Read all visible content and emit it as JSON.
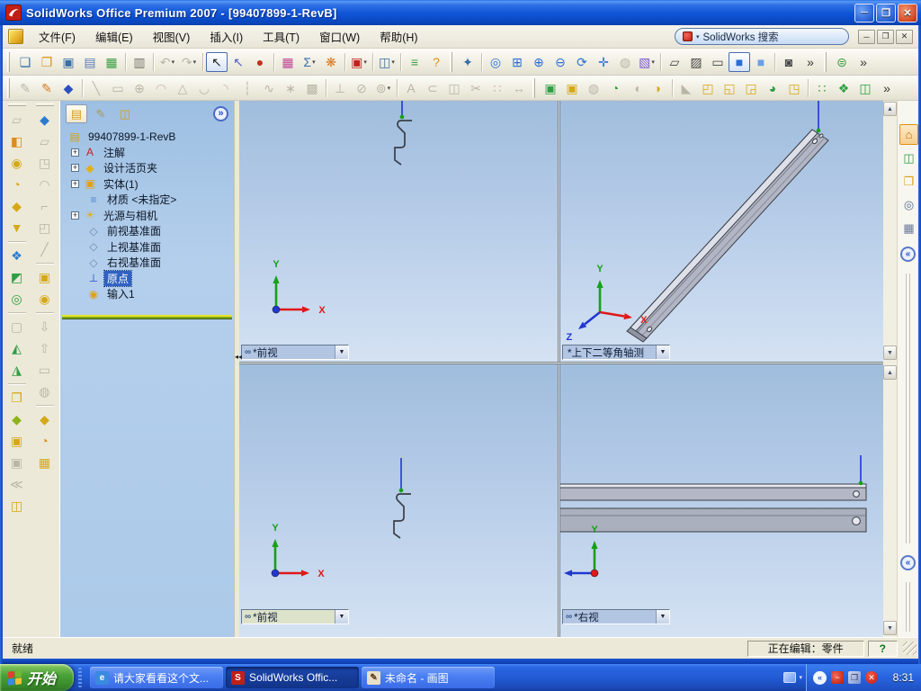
{
  "colors": {
    "titlebar_blue": "#0f54d8",
    "taskbar_blue": "#2159d2",
    "viewport_blue_top": "#a0bddd",
    "viewport_blue_bottom": "#d4e2f3",
    "selection_blue": "#2f62c2",
    "axis_x_red": "#e01818",
    "axis_y_green": "#18a018",
    "axis_z_blue": "#2038d0",
    "active_view_label": "#dde2ca"
  },
  "window": {
    "title": "SolidWorks Office Premium 2007 - [99407899-1-RevB]",
    "controls": {
      "minimize": "─",
      "restore": "❐",
      "close": "✕"
    }
  },
  "glyphs": {
    "dropdown": "▾",
    "combo_arrow": "▼",
    "link": "∞",
    "chev_right": "»",
    "chev_left": "«",
    "up": "▲",
    "down": "▼",
    "splitter_left": "◂◂",
    "plus": "+"
  },
  "menu": {
    "items": [
      {
        "n": "menu-file",
        "label": "文件(F)"
      },
      {
        "n": "menu-edit",
        "label": "编辑(E)"
      },
      {
        "n": "menu-view",
        "label": "视图(V)"
      },
      {
        "n": "menu-insert",
        "label": "插入(I)"
      },
      {
        "n": "menu-tools",
        "label": "工具(T)"
      },
      {
        "n": "menu-window",
        "label": "窗口(W)"
      },
      {
        "n": "menu-help",
        "label": "帮助(H)"
      }
    ],
    "search": {
      "text": "SolidWorks 搜索"
    }
  },
  "toolbars": {
    "main": [
      {
        "grip": 1
      },
      {
        "n": "new-document-icon",
        "g": "❏",
        "c": "#3a6ea5"
      },
      {
        "n": "open-icon",
        "g": "❐",
        "c": "#d89020"
      },
      {
        "n": "save-icon",
        "g": "▣",
        "c": "#3a6ea5"
      },
      {
        "n": "make-drawing-icon",
        "g": "▤",
        "c": "#5a7ab8"
      },
      {
        "n": "make-assembly-icon",
        "g": "▦",
        "c": "#3f9e44"
      },
      {
        "sep": 1
      },
      {
        "n": "print-icon",
        "g": "▥",
        "c": "#77736a"
      },
      {
        "sep": 1
      },
      {
        "n": "undo-icon",
        "g": "↶",
        "d": 1,
        "drop": 1
      },
      {
        "n": "redo-icon",
        "g": "↷",
        "d": 1,
        "drop": 1
      },
      {
        "sep": 1
      },
      {
        "n": "select-icon",
        "g": "↖",
        "c": "#222222",
        "p": 1
      },
      {
        "n": "select-filter-icon",
        "g": "↖",
        "c": "#5560c0"
      },
      {
        "n": "rebuild-icon",
        "g": "●",
        "c": "#c03020"
      },
      {
        "sep": 1
      },
      {
        "n": "edit-color-icon",
        "g": "▦",
        "c": "#c04898"
      },
      {
        "n": "texture-icon",
        "g": "Σ",
        "c": "#3a6ea5",
        "drop": 1
      },
      {
        "n": "photoworks-icon",
        "g": "❋",
        "c": "#d87820"
      },
      {
        "sep": 1
      },
      {
        "n": "solidworks-addins-icon",
        "g": "▣",
        "c": "#c42020",
        "drop": 1
      },
      {
        "sep": 1
      },
      {
        "n": "split-window-icon",
        "g": "◫",
        "c": "#3a6ea5",
        "drop": 1
      },
      {
        "sep": 1
      },
      {
        "n": "document-properties-icon",
        "g": "≡",
        "c": "#3f9e44"
      },
      {
        "n": "help-icon",
        "g": "?",
        "c": "#e09010"
      },
      {
        "grip": 1
      },
      {
        "n": "view-light-icon",
        "g": "✦",
        "c": "#3a6ea5"
      },
      {
        "sep": 1
      },
      {
        "n": "zoom-fit-icon",
        "g": "◎",
        "c": "#2a6ed5"
      },
      {
        "n": "zoom-area-icon",
        "g": "⊞",
        "c": "#2a6ed5"
      },
      {
        "n": "zoom-in-out-icon",
        "g": "⊕",
        "c": "#2a6ed5"
      },
      {
        "n": "zoom-selection-icon",
        "g": "⊖",
        "c": "#2a6ed5"
      },
      {
        "n": "rotate-view-icon",
        "g": "⟳",
        "c": "#2a6ed5"
      },
      {
        "n": "pan-icon",
        "g": "✛",
        "c": "#2a6ed5"
      },
      {
        "n": "standard-views-icon",
        "g": "◍",
        "d": 1
      },
      {
        "n": "view-orientation-icon",
        "g": "▧",
        "c": "#7a5ad0",
        "drop": 1
      },
      {
        "sep": 1
      },
      {
        "n": "wireframe-icon",
        "g": "▱",
        "c": "#444444"
      },
      {
        "n": "hidden-lines-visible-icon",
        "g": "▨",
        "c": "#444444"
      },
      {
        "n": "hidden-lines-removed-icon",
        "g": "▭",
        "c": "#444444"
      },
      {
        "n": "shaded-with-edges-icon",
        "g": "■",
        "c": "#2a6ed5",
        "p": 1
      },
      {
        "n": "shaded-icon",
        "g": "■",
        "c": "#6aa0e8"
      },
      {
        "sep": 1
      },
      {
        "n": "shadows-icon",
        "g": "◙",
        "c": "#444444"
      },
      {
        "n": "view-overflow-icon",
        "g": "»",
        "c": "#333333"
      },
      {
        "grip": 1
      },
      {
        "n": "enote-icon",
        "g": "⊜",
        "c": "#3f9e44"
      },
      {
        "n": "toolbar-overflow-icon",
        "g": "»",
        "c": "#333333"
      }
    ],
    "sketch": [
      {
        "grip": 1
      },
      {
        "n": "sketch-icon",
        "g": "✎",
        "d": 1
      },
      {
        "n": "3d-sketch-icon",
        "g": "✎",
        "c": "#d87820"
      },
      {
        "n": "modify-sketch-icon",
        "g": "◆",
        "c": "#2a50c0"
      },
      {
        "sep": 1
      },
      {
        "n": "line-icon",
        "g": "╲",
        "d": 1
      },
      {
        "n": "rectangle-icon",
        "g": "▭",
        "d": 1
      },
      {
        "n": "circle-icon",
        "g": "⊕",
        "d": 1
      },
      {
        "n": "centerpoint-arc-icon",
        "g": "◠",
        "d": 1
      },
      {
        "n": "polygon-icon",
        "g": "△",
        "d": 1
      },
      {
        "n": "tangent-arc-icon",
        "g": "◡",
        "d": 1
      },
      {
        "n": "three-point-arc-icon",
        "g": "◝",
        "d": 1
      },
      {
        "n": "centerline-icon",
        "g": "┆",
        "d": 1
      },
      {
        "n": "spline-icon",
        "g": "∿",
        "d": 1
      },
      {
        "n": "point-icon",
        "g": "∗",
        "d": 1
      },
      {
        "n": "hatch-icon",
        "g": "▩",
        "d": 1
      },
      {
        "sep": 1
      },
      {
        "n": "add-relation-icon",
        "g": "⊥",
        "d": 1
      },
      {
        "n": "smart-dimension-icon",
        "g": "⊘",
        "d": 1
      },
      {
        "n": "offset-entities-icon",
        "g": "⊚",
        "d": 1,
        "drop": 1
      },
      {
        "sep": 1
      },
      {
        "n": "note-icon",
        "g": "A",
        "d": 1
      },
      {
        "n": "convert-entities-icon",
        "g": "⊂",
        "d": 1
      },
      {
        "n": "mirror-entities-icon",
        "g": "◫",
        "d": 1
      },
      {
        "n": "trim-entities-icon",
        "g": "✂",
        "d": 1
      },
      {
        "n": "linear-sketch-pattern-icon",
        "g": "∷",
        "d": 1
      },
      {
        "n": "move-entities-icon",
        "g": "↔",
        "d": 1
      },
      {
        "grip": 1
      },
      {
        "n": "extruded-boss-icon",
        "g": "▣",
        "c": "#2f9e44"
      },
      {
        "n": "extruded-cut-icon",
        "g": "▣",
        "c": "#d5a818"
      },
      {
        "n": "revolved-boss-icon",
        "g": "◍",
        "d": 1
      },
      {
        "n": "swept-boss-icon",
        "g": "◔",
        "c": "#2f9e44"
      },
      {
        "n": "lofted-boss-icon",
        "g": "◖",
        "d": 1
      },
      {
        "n": "fillet-icon",
        "g": "◗",
        "c": "#d5a818"
      },
      {
        "sep": 1
      },
      {
        "n": "chamfer-icon",
        "g": "◣",
        "d": 1
      },
      {
        "n": "shell-icon",
        "g": "◰",
        "c": "#d5a818"
      },
      {
        "n": "draft-icon",
        "g": "◱",
        "c": "#d5a818"
      },
      {
        "n": "rib-icon",
        "g": "◲",
        "c": "#d5a818"
      },
      {
        "n": "dome-icon",
        "g": "◕",
        "c": "#2f9e44"
      },
      {
        "n": "hole-wizard-icon",
        "g": "◳",
        "c": "#d5a818"
      },
      {
        "sep": 1
      },
      {
        "n": "linear-pattern-icon",
        "g": "∷",
        "c": "#2f9e44"
      },
      {
        "n": "circular-pattern-icon",
        "g": "❖",
        "c": "#2f9e44"
      },
      {
        "n": "mirror-feature-icon",
        "g": "◫",
        "c": "#2f9e44"
      },
      {
        "n": "features-overflow-icon",
        "g": "»",
        "c": "#333333"
      }
    ],
    "surfaces": [
      {
        "grip": 1
      },
      {
        "n": "surface-plane-icon",
        "g": "▱",
        "d": 1
      },
      {
        "n": "extruded-surface-icon",
        "g": "◧",
        "c": "#e08a1a"
      },
      {
        "n": "revolved-surface-icon",
        "g": "◉",
        "c": "#d5a818"
      },
      {
        "n": "swept-surface-icon",
        "g": "◔",
        "c": "#d5a818"
      },
      {
        "n": "planar-surface-icon",
        "g": "◆",
        "c": "#d5a818"
      },
      {
        "n": "knit-surface-icon",
        "g": "▼",
        "c": "#d5a818"
      },
      {
        "sep": 1
      },
      {
        "n": "appearance-icon",
        "g": "❖",
        "c": "#2a7ad0"
      },
      {
        "n": "filled-surface-icon",
        "g": "◩",
        "c": "#2f9e44"
      },
      {
        "n": "check-entity-icon",
        "g": "◎",
        "c": "#2f9e44"
      },
      {
        "sep": 1
      },
      {
        "n": "untrim-surface-icon",
        "g": "▢",
        "d": 1
      },
      {
        "n": "extend-surface-icon",
        "g": "◭",
        "c": "#2f9e44"
      },
      {
        "n": "trim-surface-icon",
        "g": "◮",
        "c": "#2f9e44"
      },
      {
        "sep": 1
      },
      {
        "n": "design-binder-folder-icon",
        "g": "❐",
        "c": "#d5a818"
      },
      {
        "n": "replace-face-icon",
        "g": "◆",
        "c": "#8fb31a"
      },
      {
        "n": "move-face-icon",
        "g": "▣",
        "c": "#d5a818"
      },
      {
        "n": "offset-surface-icon",
        "g": "▣",
        "d": 1
      },
      {
        "n": "radiate-surface-icon",
        "g": "≪",
        "d": 1
      },
      {
        "n": "mirror-surface-icon",
        "g": "◫",
        "c": "#d5a818"
      }
    ],
    "sheetmetal": [
      {
        "grip": 1
      },
      {
        "n": "lofted-bend-icon",
        "g": "◆",
        "c": "#2a7ad0"
      },
      {
        "n": "base-flange-icon",
        "g": "▱",
        "d": 1
      },
      {
        "n": "edge-flange-icon",
        "g": "◳",
        "d": 1
      },
      {
        "n": "hem-icon",
        "g": "◠",
        "d": 1
      },
      {
        "n": "jog-icon",
        "g": "⌐",
        "d": 1
      },
      {
        "n": "break-corner-icon",
        "g": "◰",
        "d": 1
      },
      {
        "n": "sketched-bend-icon",
        "g": "╱",
        "d": 1
      },
      {
        "sep": 1
      },
      {
        "n": "forming-tool-icon",
        "g": "▣",
        "c": "#d5a818"
      },
      {
        "n": "cross-break-icon",
        "g": "◉",
        "c": "#d5a818"
      },
      {
        "sep": 1
      },
      {
        "n": "flatten-icon",
        "g": "⇩",
        "d": 1
      },
      {
        "n": "unfold-icon",
        "g": "⇧",
        "d": 1
      },
      {
        "n": "no-bends-icon",
        "g": "▭",
        "d": 1
      },
      {
        "n": "insert-bends-icon",
        "g": "◍",
        "d": 1
      },
      {
        "sep": 1
      },
      {
        "n": "rip-icon",
        "g": "◆",
        "c": "#d5a818"
      },
      {
        "n": "fold-icon",
        "g": "◔",
        "c": "#e08a1a"
      },
      {
        "n": "vent-icon",
        "g": "▦",
        "c": "#d5a818"
      }
    ]
  },
  "feature_tree": {
    "tabs": [
      {
        "n": "featuremanager-tab",
        "g": "▤",
        "c": "#d8a018",
        "active": true
      },
      {
        "n": "propertymanager-tab",
        "g": "✎",
        "c": "#a89858"
      },
      {
        "n": "configurationmanager-tab",
        "g": "◫",
        "c": "#d8a018"
      }
    ],
    "root": {
      "n": "tree-root",
      "label": "99407899-1-RevB",
      "g": "▤",
      "c": "#d8a018"
    },
    "items": [
      {
        "n": "tree-item-annotations",
        "label": "注解",
        "g": "A",
        "c": "#c82020",
        "plus": true
      },
      {
        "n": "tree-item-design-binder",
        "label": "设计活页夹",
        "g": "◆",
        "c": "#e0b018",
        "plus": true
      },
      {
        "n": "tree-item-solid-bodies",
        "label": "实体(1)",
        "g": "▣",
        "c": "#e0a018",
        "plus": true
      },
      {
        "n": "tree-item-material",
        "label": "材质 <未指定>",
        "g": "≡",
        "c": "#4a8ad0"
      },
      {
        "n": "tree-item-lights-cameras",
        "label": "光源与相机",
        "g": "☀",
        "c": "#e0b018",
        "plus": true
      },
      {
        "n": "tree-item-front-plane",
        "label": "前视基准面",
        "g": "◇",
        "c": "#7088b0"
      },
      {
        "n": "tree-item-top-plane",
        "label": "上视基准面",
        "g": "◇",
        "c": "#7088b0"
      },
      {
        "n": "tree-item-right-plane",
        "label": "右视基准面",
        "g": "◇",
        "c": "#7088b0"
      },
      {
        "n": "tree-item-origin",
        "label": "原点",
        "g": "⊥",
        "c": "#2a50c8",
        "selected": true
      },
      {
        "n": "tree-item-imported1",
        "label": "输入1",
        "g": "◉",
        "c": "#e0a018"
      }
    ]
  },
  "viewports": [
    {
      "n": "viewport-top-left",
      "label": "*前视",
      "linked": true,
      "active": false
    },
    {
      "n": "viewport-top-right",
      "label": "*上下二等角轴测",
      "linked": false,
      "active": false
    },
    {
      "n": "viewport-bottom-left",
      "label": "*前视",
      "linked": true,
      "active": true
    },
    {
      "n": "viewport-bottom-right",
      "label": "*右视",
      "linked": true,
      "active": false
    }
  ],
  "triad_labels": {
    "x": "X",
    "y": "Y",
    "z": "Z"
  },
  "task_pane": {
    "tabs": [
      {
        "n": "solidworks-resources-tab",
        "g": "⌂",
        "c": "#c06a10",
        "active": true
      },
      {
        "n": "design-library-tab",
        "g": "◫",
        "c": "#2f9e44"
      },
      {
        "n": "file-explorer-tab",
        "g": "❐",
        "c": "#d8a018"
      },
      {
        "n": "search-tab",
        "g": "◎",
        "c": "#556a90"
      },
      {
        "n": "custom-properties-tab",
        "g": "▦",
        "c": "#6a7a9a"
      }
    ]
  },
  "status": {
    "ready": "就绪",
    "editing": "正在编辑：零件",
    "help": "?"
  },
  "taskbar": {
    "start": "开始",
    "buttons": [
      {
        "n": "task-button-browser",
        "label": "请大家看看这个文...",
        "g": "e",
        "gc": "#ffffff",
        "gbg": "#3a8ae0"
      },
      {
        "n": "task-button-solidworks",
        "label": "SolidWorks Offic...",
        "g": "S",
        "gc": "#ffffff",
        "gbg": "#c02018",
        "active": true
      },
      {
        "n": "task-button-paint",
        "label": "未命名 - 画图",
        "g": "✎",
        "gc": "#604020",
        "gbg": "#e8e0c8"
      }
    ],
    "clock": "8:31"
  }
}
